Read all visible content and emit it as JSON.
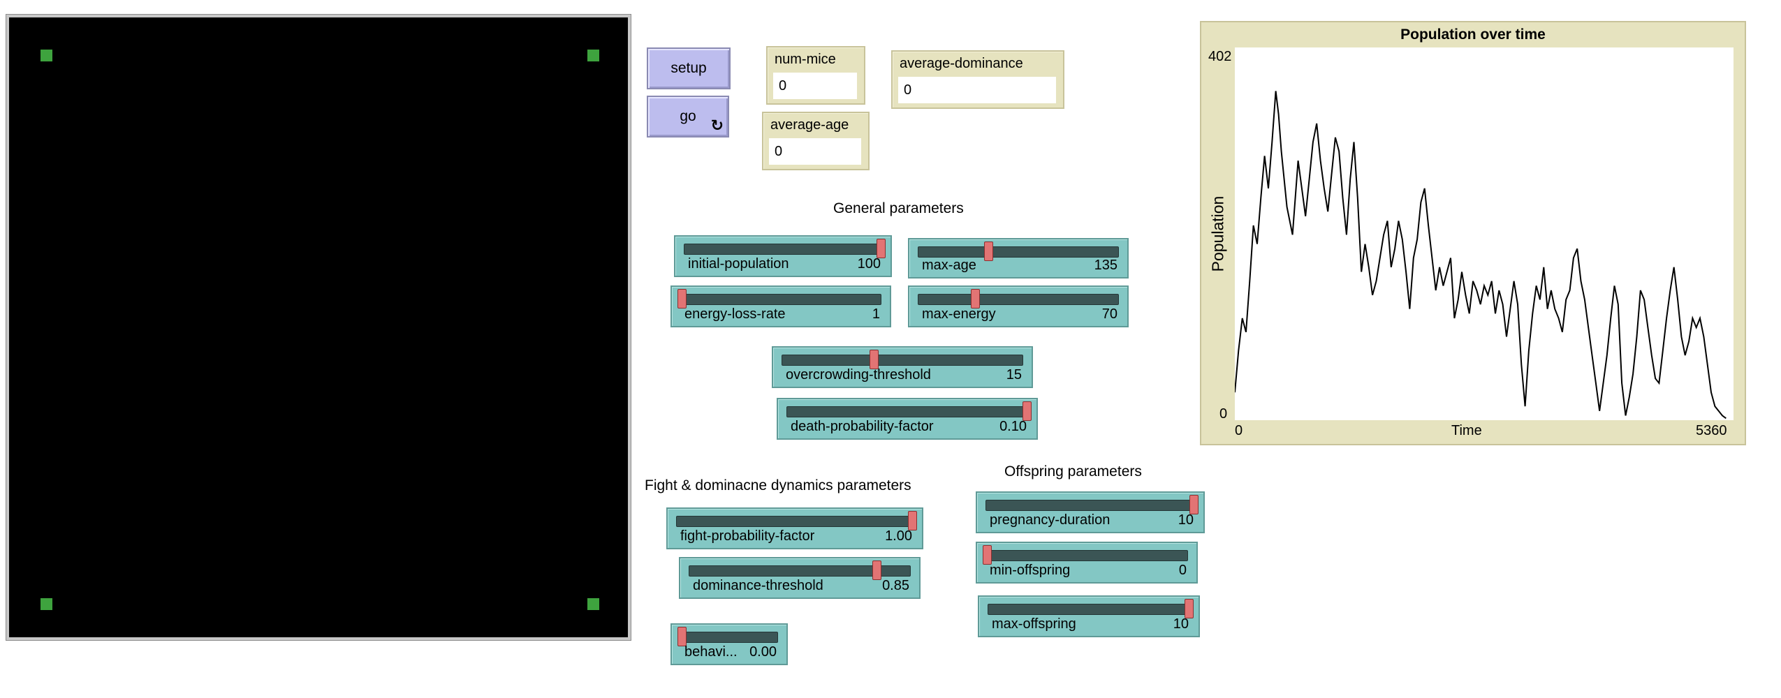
{
  "buttons": {
    "setup": "setup",
    "go": "go",
    "go_icon": "↻"
  },
  "monitors": {
    "num_mice": {
      "label": "num-mice",
      "value": "0"
    },
    "average_age": {
      "label": "average-age",
      "value": "0"
    },
    "average_dominance": {
      "label": "average-dominance",
      "value": "0"
    }
  },
  "sections": {
    "general": "General parameters",
    "fight": "Fight & dominacne dynamics parameters",
    "offspring": "Offspring parameters"
  },
  "sliders": {
    "initial_population": {
      "label": "initial-population",
      "value": "100",
      "fraction": 1.0
    },
    "max_age": {
      "label": "max-age",
      "value": "135",
      "fraction": 0.35
    },
    "energy_loss_rate": {
      "label": "energy-loss-rate",
      "value": "1",
      "fraction": 0.0
    },
    "max_energy": {
      "label": "max-energy",
      "value": "70",
      "fraction": 0.28
    },
    "overcrowding_threshold": {
      "label": "overcrowding-threshold",
      "value": "15",
      "fraction": 0.38
    },
    "death_probability_factor": {
      "label": "death-probability-factor",
      "value": "0.10",
      "fraction": 1.0
    },
    "fight_probability_factor": {
      "label": "fight-probability-factor",
      "value": "1.00",
      "fraction": 1.0
    },
    "dominance_threshold": {
      "label": "dominance-threshold",
      "value": "0.85",
      "fraction": 0.85
    },
    "behavior": {
      "label": "behavi...",
      "value": "0.00",
      "fraction": 0.0
    },
    "pregnancy_duration": {
      "label": "pregnancy-duration",
      "value": "10",
      "fraction": 1.0
    },
    "min_offspring": {
      "label": "min-offspring",
      "value": "0",
      "fraction": 0.0
    },
    "max_offspring": {
      "label": "max-offspring",
      "value": "10",
      "fraction": 1.0
    }
  },
  "colors": {
    "world_bg": "#000000",
    "patch": "#3ea33e",
    "button": "#bdbdee",
    "slider": "#83c7c4",
    "monitor": "#e6e3bf"
  },
  "chart_data": {
    "type": "line",
    "title": "Population over time",
    "xlabel": "Time",
    "ylabel": "Population",
    "xlim": [
      0,
      5360
    ],
    "ylim": [
      0,
      402
    ],
    "x_tick_labels": [
      "0",
      "5360"
    ],
    "y_tick_labels": [
      "0",
      "402"
    ],
    "grid": false,
    "series": [
      {
        "x": [
          0,
          40,
          80,
          120,
          160,
          200,
          240,
          280,
          320,
          360,
          400,
          440,
          470,
          500,
          560,
          620,
          680,
          720,
          760,
          800,
          840,
          880,
          920,
          960,
          1000,
          1040,
          1080,
          1120,
          1160,
          1200,
          1240,
          1280,
          1320,
          1360,
          1400,
          1440,
          1480,
          1520,
          1560,
          1600,
          1640,
          1680,
          1720,
          1760,
          1800,
          1840,
          1880,
          1920,
          1960,
          2000,
          2040,
          2080,
          2120,
          2160,
          2200,
          2240,
          2280,
          2320,
          2360,
          2400,
          2440,
          2480,
          2520,
          2560,
          2600,
          2640,
          2680,
          2720,
          2760,
          2800,
          2840,
          2880,
          2920,
          2960,
          3000,
          3040,
          3080,
          3120,
          3160,
          3200,
          3240,
          3280,
          3320,
          3360,
          3400,
          3440,
          3480,
          3520,
          3560,
          3600,
          3640,
          3680,
          3720,
          3760,
          3800,
          3840,
          3880,
          3920,
          3960,
          4000,
          4040,
          4080,
          4120,
          4160,
          4200,
          4240,
          4280,
          4320,
          4360,
          4400,
          4440,
          4480,
          4520,
          4560,
          4600,
          4640,
          4680,
          4720,
          4760,
          4800,
          4840,
          4880,
          4920,
          4960,
          5000,
          5040,
          5080,
          5120,
          5160,
          5200,
          5240,
          5280
        ],
        "y": [
          30,
          75,
          110,
          95,
          150,
          210,
          190,
          240,
          285,
          250,
          300,
          355,
          330,
          290,
          230,
          200,
          280,
          250,
          220,
          260,
          300,
          320,
          280,
          250,
          225,
          265,
          305,
          290,
          240,
          200,
          260,
          300,
          240,
          160,
          190,
          165,
          135,
          150,
          175,
          200,
          215,
          165,
          185,
          215,
          195,
          160,
          120,
          175,
          195,
          235,
          250,
          210,
          175,
          140,
          165,
          145,
          160,
          175,
          110,
          130,
          160,
          135,
          115,
          150,
          140,
          125,
          145,
          135,
          150,
          115,
          140,
          125,
          90,
          120,
          150,
          125,
          60,
          15,
          75,
          115,
          145,
          130,
          165,
          120,
          140,
          120,
          110,
          95,
          130,
          140,
          175,
          185,
          150,
          130,
          100,
          70,
          40,
          10,
          40,
          70,
          110,
          145,
          125,
          40,
          5,
          25,
          50,
          90,
          140,
          130,
          100,
          70,
          45,
          40,
          75,
          110,
          140,
          165,
          130,
          90,
          70,
          85,
          110,
          100,
          110,
          90,
          60,
          30,
          15,
          10,
          5,
          2
        ]
      }
    ]
  }
}
